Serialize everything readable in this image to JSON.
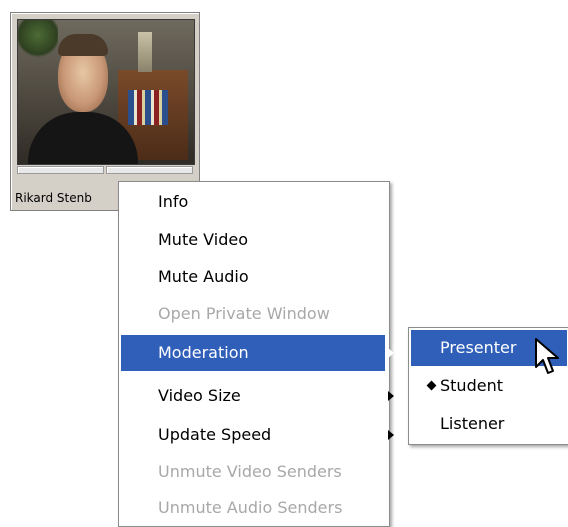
{
  "participant": {
    "name": "Rikard Stenb",
    "audio_level": 0,
    "video_level": 0
  },
  "context_menu": {
    "items": [
      {
        "label": "Info",
        "enabled": true
      },
      {
        "label": "Mute Video",
        "enabled": true
      },
      {
        "label": "Mute Audio",
        "enabled": true
      },
      {
        "label": "Open Private Window",
        "enabled": false
      },
      {
        "label": "Moderation",
        "enabled": true,
        "submenu": true,
        "highlighted": true
      },
      {
        "label": "Video Size",
        "enabled": true,
        "submenu": true
      },
      {
        "label": "Update Speed",
        "enabled": true,
        "submenu": true
      },
      {
        "label": "Unmute Video Senders",
        "enabled": false
      },
      {
        "label": "Unmute Audio Senders",
        "enabled": false
      }
    ]
  },
  "moderation_submenu": {
    "items": [
      {
        "label": "Presenter",
        "highlighted": true
      },
      {
        "label": "Student",
        "checked": true
      },
      {
        "label": "Listener"
      }
    ]
  },
  "colors": {
    "highlight": "#2f5fb9",
    "disabled_text": "#a8a8a8",
    "tile_bg": "#d4d0c8"
  },
  "icons": [
    "submenu-arrow-icon",
    "radio-bullet-icon",
    "mouse-pointer-icon"
  ]
}
